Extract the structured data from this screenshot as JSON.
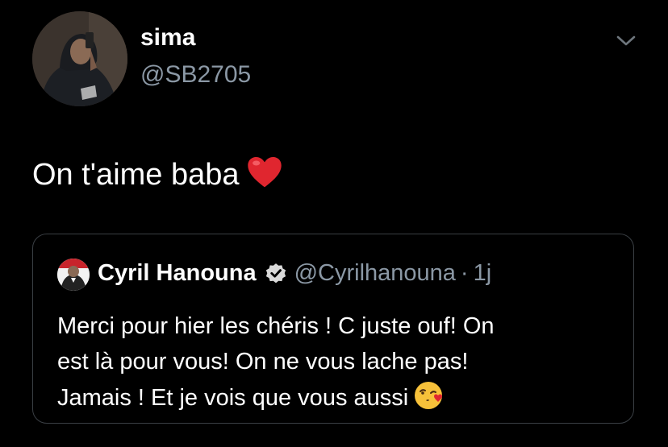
{
  "author": {
    "display_name": "sima",
    "handle": "@SB2705"
  },
  "tweet": {
    "text": "On t'aime baba",
    "emoji": "red-heart"
  },
  "quoted_tweet": {
    "display_name": "Cyril Hanouna",
    "verified": true,
    "handle": "@Cyrilhanouna",
    "separator": "·",
    "time": "1j",
    "lines": [
      "Merci pour hier les chéris ! C juste ouf! On",
      "est là pour vous! On ne vous lache pas!",
      "Jamais ! Et je vois que vous aussi"
    ],
    "emoji": "face-blowing-kiss"
  },
  "colors": {
    "background": "#000000",
    "text": "#ffffff",
    "secondary_text": "#8b98a5",
    "border": "#3a3f44"
  }
}
